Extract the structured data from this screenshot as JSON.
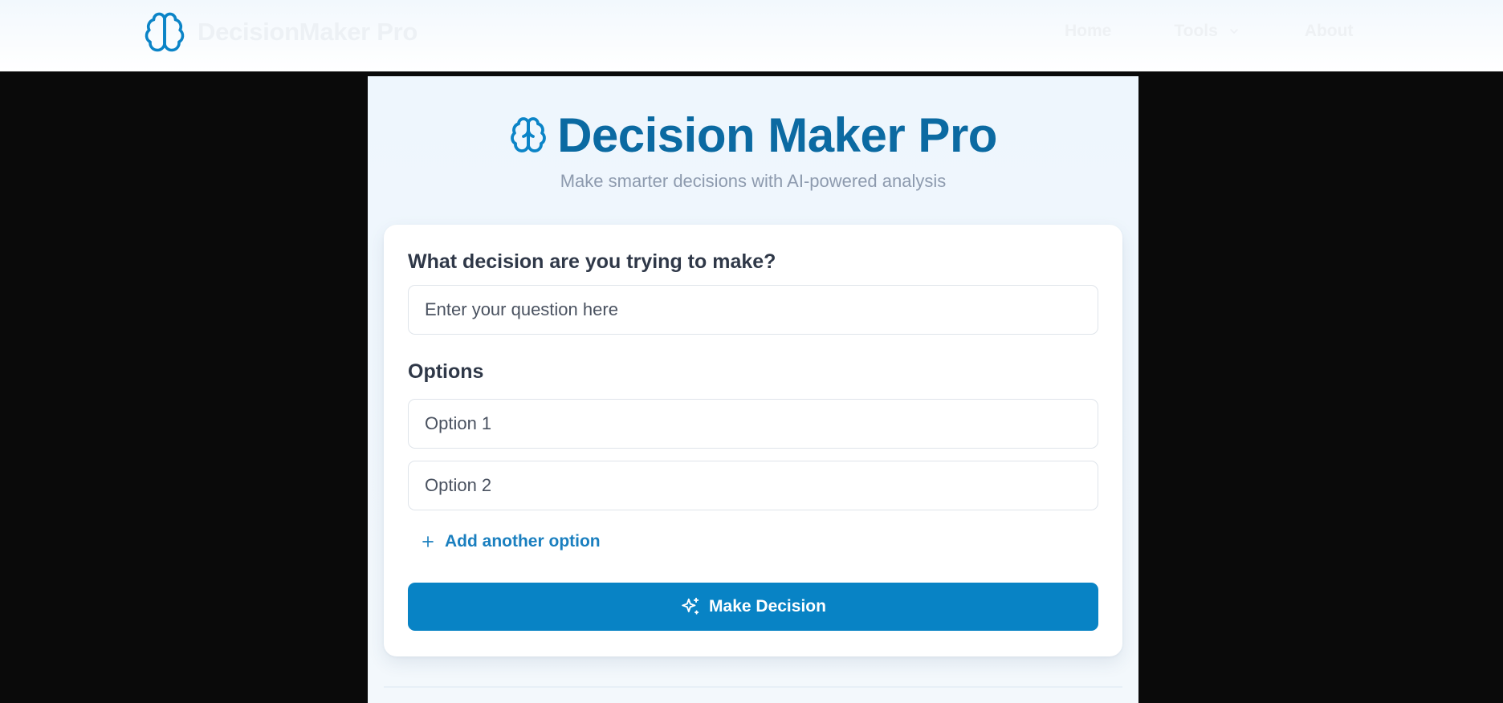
{
  "nav": {
    "brand_name": "DecisionMaker Pro",
    "brand_icon": "brain-icon",
    "links": [
      {
        "label": "Home"
      },
      {
        "label": "Tools",
        "icon": "chevron-down-icon"
      },
      {
        "label": "About"
      }
    ]
  },
  "hero": {
    "icon": "brain-icon",
    "title": "Decision Maker Pro",
    "subtitle": "Make smarter decisions with AI-powered analysis"
  },
  "form": {
    "question_label": "What decision are you trying to make?",
    "question_placeholder": "Enter your question here",
    "options_label": "Options",
    "options": [
      {
        "placeholder": "Option 1"
      },
      {
        "placeholder": "Option 2"
      }
    ],
    "add_option_label": "Add another option",
    "add_option_icon": "plus-icon",
    "submit_label": "Make Decision",
    "submit_icon": "sparkle-icon"
  },
  "colors": {
    "accent": "#0883c5",
    "title": "#0b6aa2",
    "link": "#1a7fbf",
    "background_outer": "#0a0a0a"
  }
}
